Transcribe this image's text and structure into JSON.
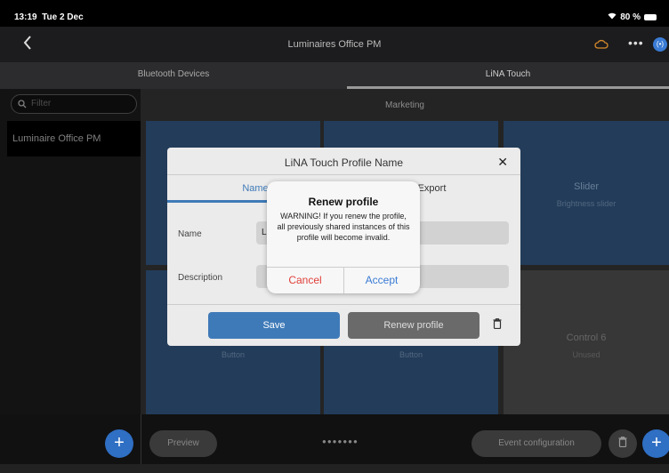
{
  "status": {
    "time": "13:19",
    "date": "Tue 2 Dec",
    "battery": "80 %"
  },
  "nav": {
    "title": "Luminaires Office PM",
    "back_icon": "chevron-left-icon",
    "cloud_icon": "cloud-icon",
    "more": "•••",
    "bt_label": "(•)"
  },
  "tabs": {
    "bluetooth": "Bluetooth Devices",
    "lina": "LiNA Touch"
  },
  "sidebar": {
    "filter_placeholder": "Filter",
    "items": [
      {
        "label": "Luminaire Office PM"
      }
    ]
  },
  "main": {
    "header": "Marketing",
    "tiles": [
      {
        "name": "Slider",
        "sub": "Brightness slider"
      },
      {
        "name": "",
        "sub": "Button"
      },
      {
        "name": "",
        "sub": "Button"
      },
      {
        "name": "Control 6",
        "sub": "Unused"
      }
    ]
  },
  "bottom": {
    "preview": "Preview",
    "event_config": "Event configuration",
    "dots": "●●●●●●●",
    "add": "+"
  },
  "dialog": {
    "title": "LiNA Touch Profile Name",
    "close": "✕",
    "tab_name": "Name",
    "tab_export": "Export",
    "name_label": "Name",
    "name_value": "L",
    "description_label": "Description",
    "save": "Save",
    "renew": "Renew profile"
  },
  "alert": {
    "title": "Renew profile",
    "message": "WARNING! If you renew the profile, all previously shared instances of this profile will become invalid.",
    "cancel": "Cancel",
    "accept": "Accept"
  },
  "colors": {
    "accent": "#3f7ab8",
    "tile_blue": "#2f5178",
    "danger": "#e0403a",
    "cloud": "#d98a2a"
  }
}
